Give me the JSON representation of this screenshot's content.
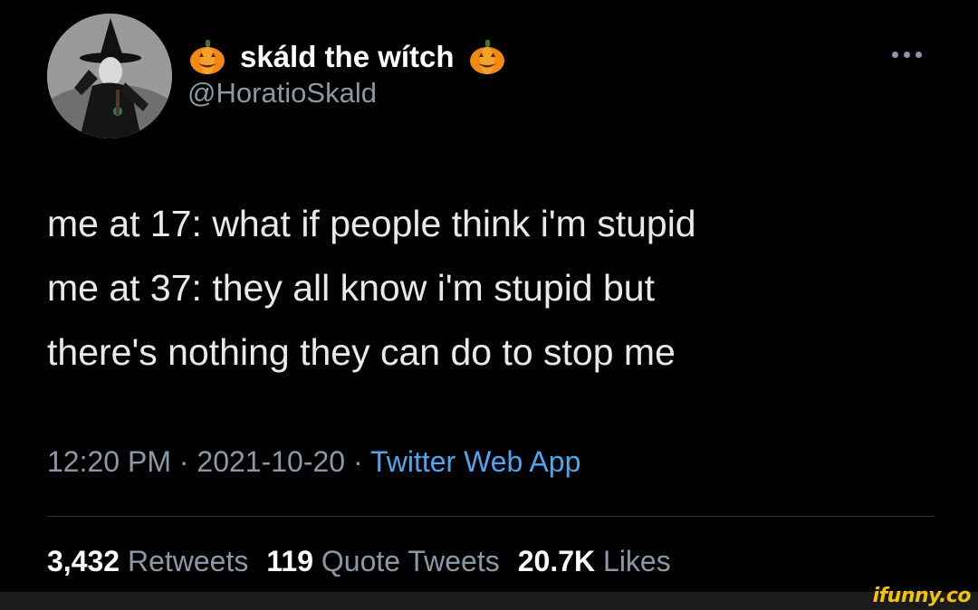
{
  "tweet": {
    "display_name": "skáld the wítch",
    "handle": "@HoratioSkald",
    "name_emoji_left": "pumpkin-icon",
    "name_emoji_right": "pumpkin-icon",
    "more_icon": "more-horizontal-icon",
    "text_lines": [
      "me at 17: what if people think i'm stupid",
      "me at 37: they all know i'm stupid but",
      "there's nothing they can do to stop me"
    ],
    "time": "12:20 PM",
    "separator": " · ",
    "date": "2021-10-20",
    "source": "Twitter Web App",
    "stats": {
      "retweets_count": "3,432",
      "retweets_label": "Retweets",
      "quotes_count": "119",
      "quotes_label": "Quote Tweets",
      "likes_count": "20.7K",
      "likes_label": "Likes"
    }
  },
  "watermark": "ifunny.co",
  "colors": {
    "background": "#000000",
    "text": "#e7e9ea",
    "secondary": "#8b98a5",
    "link": "#4ea6ee",
    "watermark": "#f5c400"
  }
}
